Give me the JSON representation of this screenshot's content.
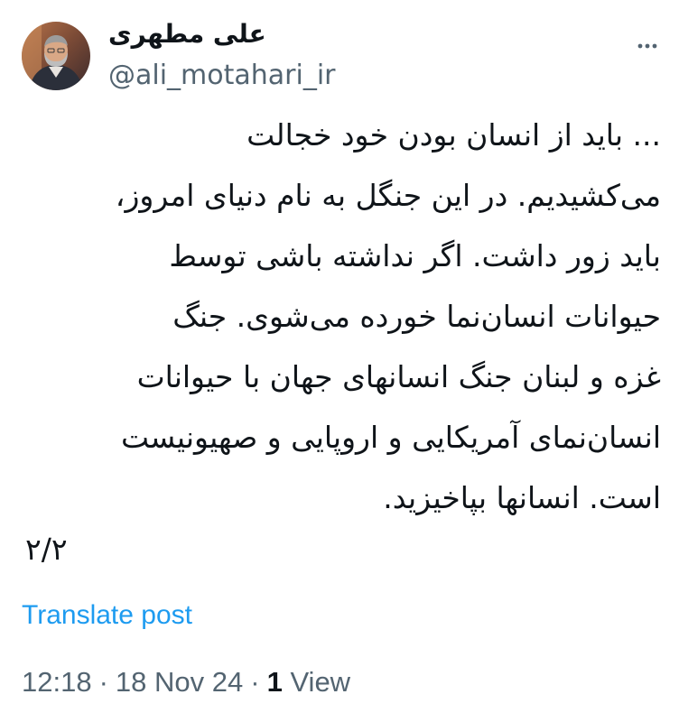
{
  "author": {
    "display_name": "علی مطهری",
    "handle": "@ali_motahari_ir",
    "avatar_icon": "person-avatar"
  },
  "post": {
    "lines": [
      "... باید از انسان بودن خود خجالت",
      "می‌کشیدیم. در این جنگل به نام دنیای امروز،",
      "باید زور داشت. اگر نداشته باشی توسط",
      "حیوانات انسان‌نما خورده می‌شوی. جنگ",
      "غزه و لبنان جنگ انسانهای جهان با حیوانات",
      "انسان‌نمای آمریکایی و اروپایی و صهیونیست",
      "است. انسانها بپاخیزید."
    ],
    "thread_counter": "۲/۲",
    "translate_label": "Translate post"
  },
  "meta": {
    "time": "12:18",
    "separator": "·",
    "date": "18 Nov 24",
    "views_count": "1",
    "views_label": "View"
  },
  "icons": {
    "more": "more-dots-icon"
  },
  "colors": {
    "link": "#1d9bf0",
    "secondary_text": "#536471",
    "primary_text": "#0f1419"
  }
}
